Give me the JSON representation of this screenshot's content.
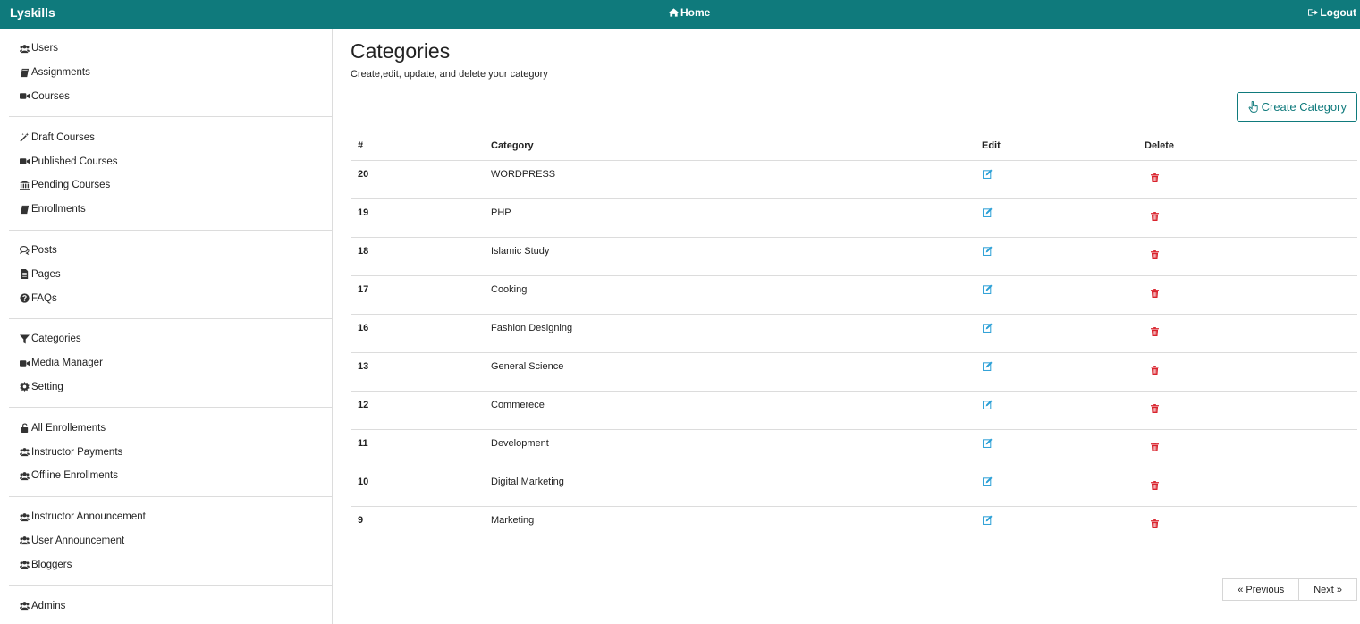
{
  "app": {
    "brand": "Lyskills",
    "home_label": "Home",
    "logout_label": "Logout"
  },
  "sidebar": {
    "groups": [
      [
        {
          "label": "Users",
          "icon": "users-icon"
        },
        {
          "label": "Assignments",
          "icon": "book-icon"
        },
        {
          "label": "Courses",
          "icon": "video-icon"
        }
      ],
      [
        {
          "label": "Draft Courses",
          "icon": "magic-icon"
        },
        {
          "label": "Published Courses",
          "icon": "video-icon"
        },
        {
          "label": "Pending Courses",
          "icon": "bank-icon"
        },
        {
          "label": "Enrollments",
          "icon": "book-icon"
        }
      ],
      [
        {
          "label": "Posts",
          "icon": "comments-icon"
        },
        {
          "label": "Pages",
          "icon": "file-icon"
        },
        {
          "label": "FAQs",
          "icon": "question-icon"
        }
      ],
      [
        {
          "label": "Categories",
          "icon": "filter-icon"
        },
        {
          "label": "Media Manager",
          "icon": "video-icon"
        },
        {
          "label": "Setting",
          "icon": "gear-icon"
        }
      ],
      [
        {
          "label": "All Enrollements",
          "icon": "unlock-icon"
        },
        {
          "label": "Instructor Payments",
          "icon": "users-icon"
        },
        {
          "label": "Offline Enrollments",
          "icon": "users-icon"
        }
      ],
      [
        {
          "label": "Instructor Announcement",
          "icon": "users-icon"
        },
        {
          "label": "User Announcement",
          "icon": "users-icon"
        },
        {
          "label": "Bloggers",
          "icon": "users-icon"
        }
      ],
      [
        {
          "label": "Admins",
          "icon": "users-icon"
        }
      ]
    ]
  },
  "main": {
    "title": "Categories",
    "subtitle": "Create,edit, update, and delete your category",
    "create_label": "Create Category",
    "table": {
      "headers": {
        "num": "#",
        "category": "Category",
        "edit": "Edit",
        "delete": "Delete"
      },
      "rows": [
        {
          "id": "20",
          "name": "WORDPRESS"
        },
        {
          "id": "19",
          "name": "PHP"
        },
        {
          "id": "18",
          "name": "Islamic Study"
        },
        {
          "id": "17",
          "name": "Cooking"
        },
        {
          "id": "16",
          "name": "Fashion Designing"
        },
        {
          "id": "13",
          "name": "General Science"
        },
        {
          "id": "12",
          "name": "Commerece"
        },
        {
          "id": "11",
          "name": "Development"
        },
        {
          "id": "10",
          "name": "Digital Marketing"
        },
        {
          "id": "9",
          "name": "Marketing"
        }
      ]
    },
    "pager": {
      "prev_label": "« Previous",
      "next_label": "Next »"
    }
  },
  "colors": {
    "accent": "#0f7a7c",
    "edit": "#2a9fd6",
    "delete": "#d9232d"
  }
}
